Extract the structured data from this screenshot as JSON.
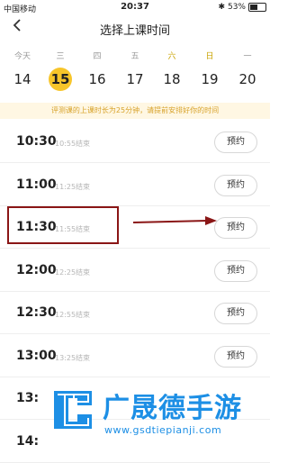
{
  "status_bar": {
    "carrier": "中国移动",
    "time": "20:37",
    "battery": "53%",
    "battery_level": 0.53,
    "icons": [
      "wifi-icon",
      "alarm-icon",
      "bluetooth-icon",
      "battery-icon"
    ]
  },
  "header": {
    "title": "选择上课时间",
    "back_icon": "chevron-left-icon"
  },
  "week": {
    "weekdays": [
      "今天",
      "三",
      "四",
      "五",
      "六",
      "日",
      "一"
    ],
    "dates": [
      "14",
      "15",
      "16",
      "17",
      "18",
      "19",
      "20"
    ],
    "selected_index": 1,
    "weekend_indices": [
      4,
      5
    ]
  },
  "notice": "评测课的上课时长为25分钟，请提前安排好你的时间",
  "slots": [
    {
      "start": "10:30",
      "end": "10:55结束",
      "action": "预约"
    },
    {
      "start": "11:00",
      "end": "11:25结束",
      "action": "预约"
    },
    {
      "start": "11:30",
      "end": "11:55结束",
      "action": "预约"
    },
    {
      "start": "12:00",
      "end": "12:25结束",
      "action": "预约"
    },
    {
      "start": "12:30",
      "end": "12:55结束",
      "action": "预约"
    },
    {
      "start": "13:00",
      "end": "13:25结束",
      "action": "预约"
    },
    {
      "start": "13:",
      "end": "",
      "action": ""
    },
    {
      "start": "14:",
      "end": "",
      "action": ""
    }
  ],
  "watermark": {
    "brand": "广晟德手游",
    "url": "www.gsdtiepianji.com",
    "icon": "logo-icon"
  },
  "colors": {
    "accent": "#f7c52a",
    "annotation": "#8a1616",
    "notice_bg": "#fff7e3",
    "notice_text": "#d7a22a",
    "watermark": "#1d8fe5"
  }
}
